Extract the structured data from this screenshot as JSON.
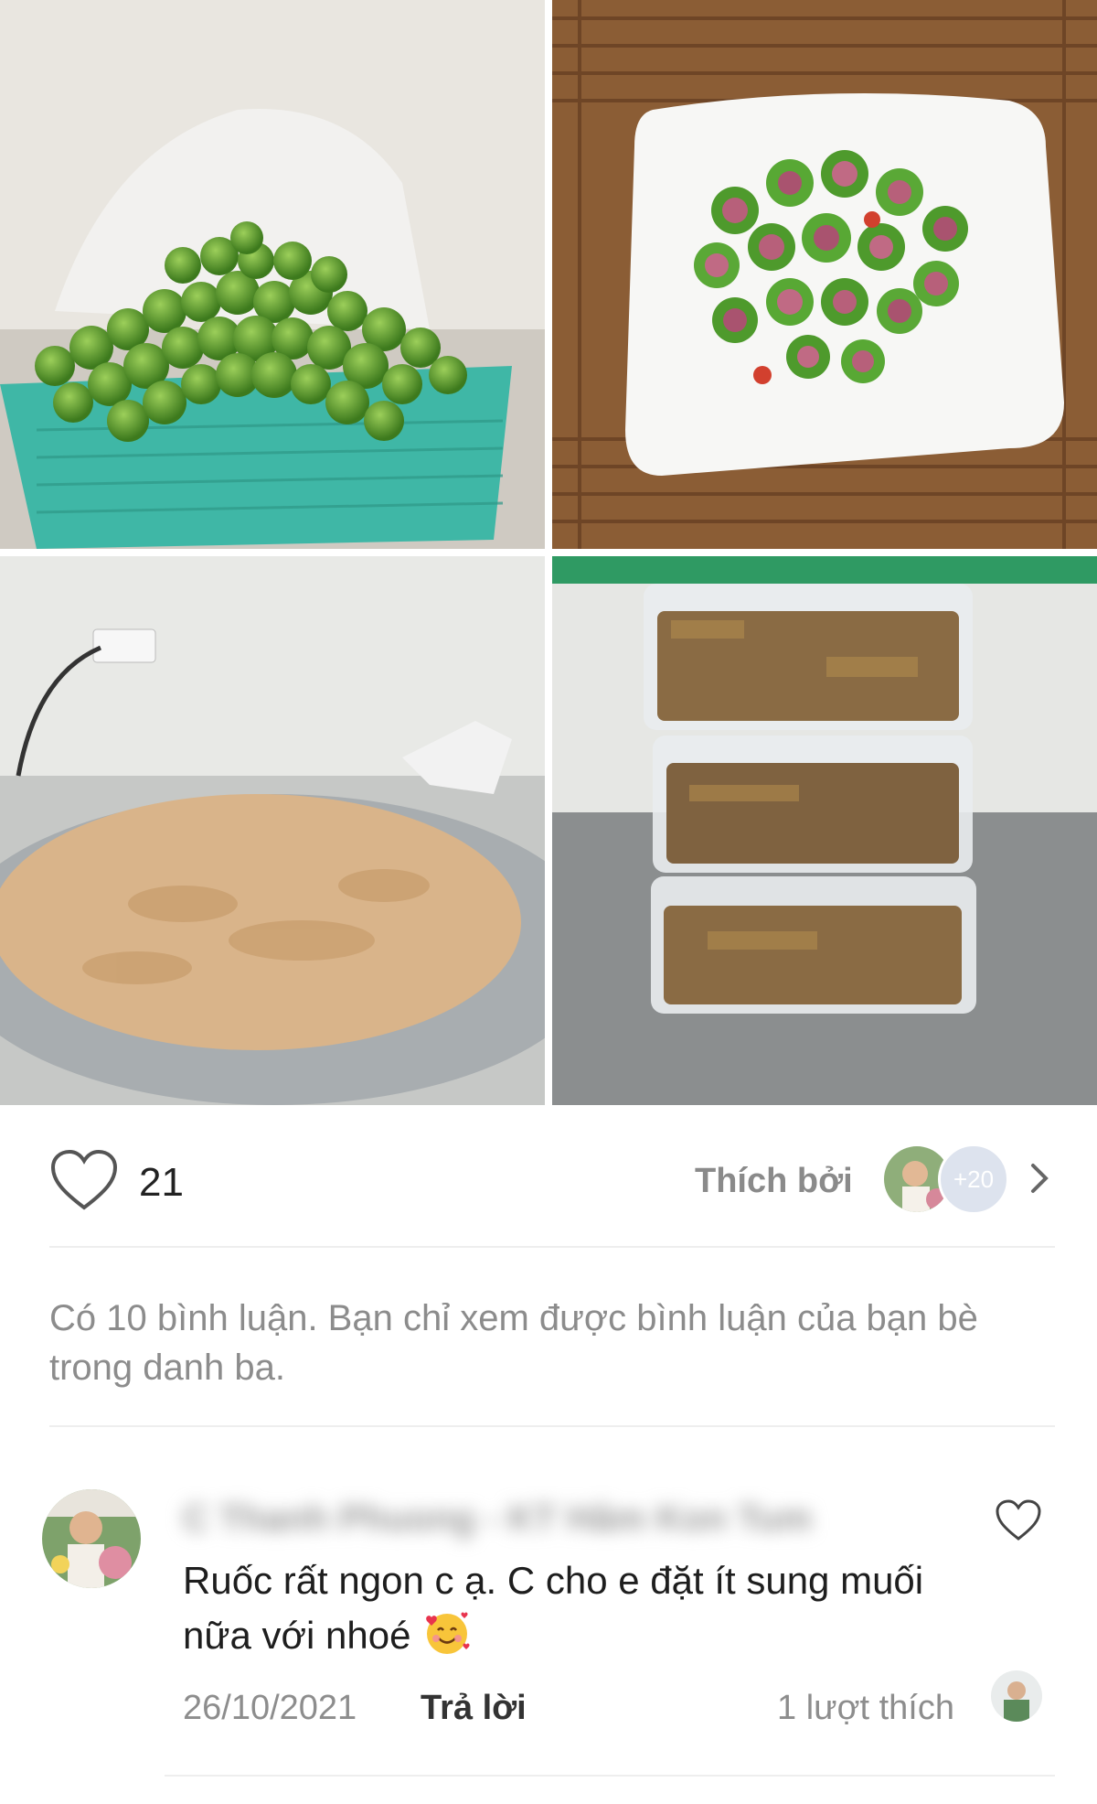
{
  "post": {
    "photos": [
      {
        "name": "photo-figs-basket"
      },
      {
        "name": "photo-pickled-figs-plate"
      },
      {
        "name": "photo-pork-floss-tray"
      },
      {
        "name": "photo-floss-containers"
      }
    ],
    "like_count": "21",
    "liked_by_label": "Thích bởi",
    "liked_by_more": "+20",
    "comments_notice": "Có 10 bình luận. Bạn chỉ xem được bình luận của bạn bè trong danh ba."
  },
  "comment": {
    "author": "C Thanh Phuong - KT Hâm Kon Tum",
    "text": "Ruốc rất ngon c ạ. C cho e đặt ít sung muối nữa với nhoé",
    "emoji": "smiling-face-with-hearts",
    "date": "26/10/2021",
    "reply_label": "Trả lời",
    "likes_label": "1 lượt thích"
  },
  "colors": {
    "muted_text": "#8c8c8c",
    "divider": "#eeeeee",
    "badge_bg": "#dde3ee"
  },
  "icons": [
    "heart-outline-icon",
    "chevron-right-icon",
    "comment-heart-icon",
    "smiling-face-with-hearts-emoji"
  ]
}
